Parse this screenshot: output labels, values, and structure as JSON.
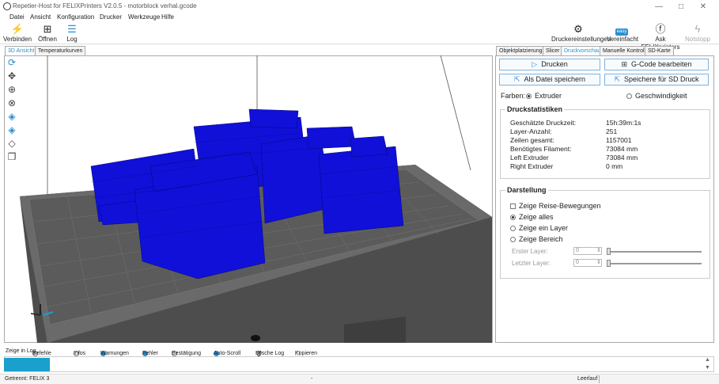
{
  "window": {
    "title": "Repetier-Host for FELIXPrinters V2.0.5 - motorblock verhal.gcode",
    "minimize": "—",
    "maximize": "□",
    "close": "✕"
  },
  "menu": [
    "Datei",
    "Ansicht",
    "Konfiguration",
    "Drucker",
    "Werkzeuge",
    "Hilfe"
  ],
  "toolbar": {
    "connect": "Verbinden",
    "open": "Öffnen",
    "log": "Log",
    "printer_settings": "Druckereinstellungen",
    "simplified": "Vereinfacht",
    "simplified_badge": "easy",
    "ask_felix": "Ask FELIXprinters",
    "emergency": "Notstopp"
  },
  "left_tabs": [
    "3D Ansicht",
    "Temperaturkurven"
  ],
  "right_tabs": [
    "Objektplatzierung",
    "Slicer",
    "Druckvorschau",
    "Manuelle Kontrolle",
    "SD-Karte"
  ],
  "preview": {
    "print_button": "Drucken",
    "edit_gcode_button": "G-Code bearbeiten",
    "save_file_button": "Als Datei speichern",
    "save_sd_button": "Speichere für SD Druck",
    "colors_label": "Farben:",
    "color_options": [
      "Extruder",
      "Geschwindigkeit"
    ],
    "stats_title": "Druckstatistiken",
    "stats": [
      {
        "label": "Geschätzte Druckzeit:",
        "value": "15h:39m:1s"
      },
      {
        "label": "Layer-Anzahl:",
        "value": "251"
      },
      {
        "label": "Zeilen gesamt:",
        "value": "1157001"
      },
      {
        "label": "Benötigtes Filament:",
        "value": "73084 mm"
      },
      {
        "label": "Left Extruder",
        "value": "73084 mm"
      },
      {
        "label": "Right Extruder",
        "value": "0 mm"
      }
    ],
    "display_title": "Darstellung",
    "show_travel": "Zeige Reise-Bewegungen",
    "show_options": [
      "Zeige alles",
      "Zeige ein Layer",
      "Zeige Bereich"
    ],
    "first_layer_label": "Erster Layer:",
    "last_layer_label": "Letzter Layer:",
    "first_layer_value": "0",
    "last_layer_value": "0"
  },
  "log": {
    "show_in_log": "Zeige in Log",
    "filters": [
      "Befehle",
      "Infos",
      "Warnungen",
      "Fehler",
      "Bestätigung",
      "Auto-Scroll"
    ],
    "clear": "Lösche Log",
    "copy": "Kopieren"
  },
  "status": {
    "connection": "Getrennt: FELIX 3",
    "middle": "-",
    "idle": "Leerlauf"
  },
  "colors": {
    "accent": "#2a8fd0",
    "model": "#1010d8",
    "bed": "#5a5a5a",
    "log_blue": "#1aa0cc"
  }
}
